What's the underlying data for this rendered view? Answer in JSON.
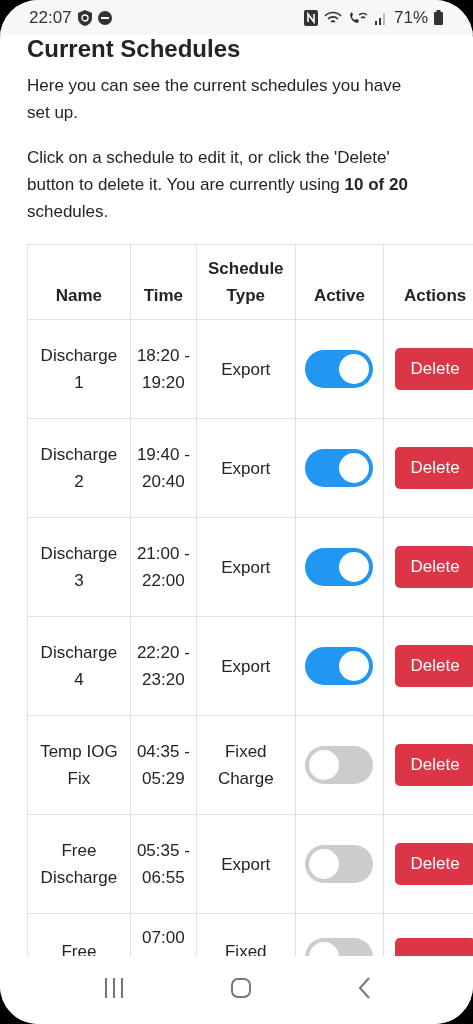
{
  "status_bar": {
    "time": "22:07",
    "battery": "71%"
  },
  "title": "Current Schedules",
  "intro": "Here you can see the current schedules you have set up.",
  "instructions": "Click on a schedule to edit it, or click the 'Delete' button to delete it. You are currently using **10 of 20** schedules.",
  "table": {
    "columns": [
      "Name",
      "Time",
      "Schedule Type",
      "Active",
      "Actions"
    ],
    "rows": [
      {
        "name": "Discharge 1",
        "time": "18:20 - 19:20",
        "type": "Export",
        "active": true,
        "action": "Delete"
      },
      {
        "name": "Discharge 2",
        "time": "19:40 - 20:40",
        "type": "Export",
        "active": true,
        "action": "Delete"
      },
      {
        "name": "Discharge 3",
        "time": "21:00 - 22:00",
        "type": "Export",
        "active": true,
        "action": "Delete"
      },
      {
        "name": "Discharge 4",
        "time": "22:20 - 23:20",
        "type": "Export",
        "active": true,
        "action": "Delete"
      },
      {
        "name": "Temp IOG Fix",
        "time": "04:35 - 05:29",
        "type": "Fixed Charge",
        "active": false,
        "action": "Delete"
      },
      {
        "name": "Free Discharge",
        "time": "05:35 - 06:55",
        "type": "Export",
        "active": false,
        "action": "Delete"
      },
      {
        "name": "Free",
        "time": "07:00",
        "type": "Fixed",
        "active": false,
        "kind": "cut"
      }
    ]
  }
}
